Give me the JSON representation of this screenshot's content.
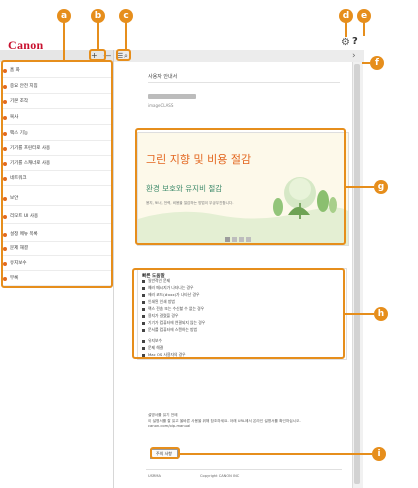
{
  "header": {
    "logo_text": "Canon",
    "help_label": "?"
  },
  "toolbar": {
    "expand": "+",
    "collapse": "—",
    "chevron": "›"
  },
  "sidebar": {
    "items": [
      {
        "label": "홈 화"
      },
      {
        "label": "중요 안전 지침"
      },
      {
        "label": "기본 조작"
      },
      {
        "label": "복사"
      },
      {
        "label": "팩스 기능"
      },
      {
        "label": "기기를 프린터로 사용"
      },
      {
        "label": "기기를 스캐너로 사용"
      },
      {
        "label": "네트워크"
      },
      {
        "label": "보안"
      },
      {
        "label": "리모트 UI 사용"
      },
      {
        "label": "설정 메뉴 목록"
      },
      {
        "label": "문제 해결"
      },
      {
        "label": "유지보수"
      },
      {
        "label": "부록"
      }
    ]
  },
  "content": {
    "doc_title": "사용자 안내서",
    "doc_subtitle": "imageCLASS",
    "banner": {
      "title": "그린 지향 및 비용 절감",
      "subtitle": "환경 보호와 유지비 절감",
      "description": "용지, 토너, 전력, 비용을 절감하는 방법이 무궁무진합니다."
    },
    "quick": {
      "heading": "빠른 도움말",
      "items": [
        "일반적인 문제",
        "예러 메시지가 나타나는 경우",
        "에러 코드(#xxx)가 나타난 경우",
        "인쇄된 인쇄 방법",
        "팩스 전송 또는 수신할 수 없는 경우",
        "용지가 걸렸을 경우",
        "기기가 컴퓨터에 연결되지 않는 경우",
        "문서를 컴퓨터에 스캔하는 방법",
        "유지보수",
        "문제 해결",
        "Mac OS 사용자의 경우"
      ]
    },
    "note_line1": "설명서를 읽기 전에",
    "note_line2": "이 설명서를 잘 읽고 올바른 사용을 위해 참조하세요. 아래 URL에서 온라인 설명서를 확인하십시오.",
    "note_url": "canon.com/oip-manual",
    "notice_button": "주의 사항",
    "footer_code": "USRMA",
    "footer_copyright": "Copyright CANON INC"
  },
  "callouts": {
    "a": "a",
    "b": "b",
    "c": "c",
    "d": "d",
    "e": "e",
    "f": "f",
    "g": "g",
    "h": "h",
    "i": "i"
  },
  "colors": {
    "accent": "#e68e1c",
    "brand": "#c8102e"
  }
}
